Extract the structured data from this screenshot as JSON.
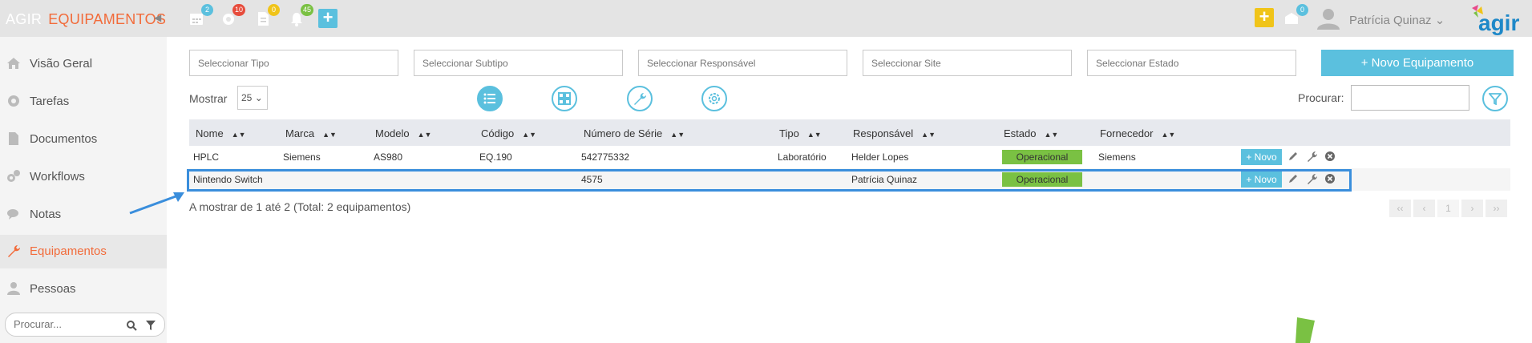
{
  "header": {
    "brand": "AGIR",
    "module": "EQUIPAMENTOS",
    "badges": {
      "calendar": "2",
      "tasks": "10",
      "documents": "0",
      "notifications": "45",
      "inbox": "0"
    },
    "user_name": "Patrícia Quinaz",
    "logo_text": "agir"
  },
  "sidebar": {
    "items": [
      {
        "label": "Visão Geral",
        "icon": "home-icon"
      },
      {
        "label": "Tarefas",
        "icon": "gear-icon"
      },
      {
        "label": "Documentos",
        "icon": "document-icon"
      },
      {
        "label": "Workflows",
        "icon": "cogs-icon"
      },
      {
        "label": "Notas",
        "icon": "comments-icon"
      },
      {
        "label": "Equipamentos",
        "icon": "wrench-icon"
      },
      {
        "label": "Pessoas",
        "icon": "user-icon"
      }
    ],
    "active": "Equipamentos",
    "search_placeholder": "Procurar..."
  },
  "filters": {
    "tipo": "Seleccionar Tipo",
    "subtipo": "Seleccionar Subtipo",
    "responsavel": "Seleccionar Responsável",
    "site": "Seleccionar Site",
    "estado": "Seleccionar Estado"
  },
  "new_button": "+ Novo Equipamento",
  "toolbar": {
    "mostrar_label": "Mostrar",
    "page_size": "25",
    "procurar_label": "Procurar:"
  },
  "table": {
    "columns": [
      "Nome",
      "Marca",
      "Modelo",
      "Código",
      "Número de Série",
      "Tipo",
      "Responsável",
      "Estado",
      "Fornecedor"
    ],
    "rows": [
      {
        "nome": "HPLC",
        "marca": "Siemens",
        "modelo": "AS980",
        "codigo": "EQ.190",
        "serie": "542775332",
        "tipo": "Laboratório",
        "responsavel": "Helder Lopes",
        "estado": "Operacional",
        "fornecedor": "Siemens"
      },
      {
        "nome": "Nintendo Switch",
        "marca": "",
        "modelo": "",
        "codigo": "",
        "serie": "4575",
        "tipo": "",
        "responsavel": "Patrícia Quinaz",
        "estado": "Operacional",
        "fornecedor": ""
      }
    ],
    "row_new_label": "+ Novo"
  },
  "summary": "A mostrar de 1 até 2 (Total: 2 equipamentos)",
  "pagination": [
    "‹‹",
    "‹",
    "1",
    "›",
    "››"
  ],
  "colors": {
    "accent": "#5bc0de",
    "brand_orange": "#f26b3a",
    "status_green": "#7ac143",
    "highlight_blue": "#3a8edc"
  }
}
